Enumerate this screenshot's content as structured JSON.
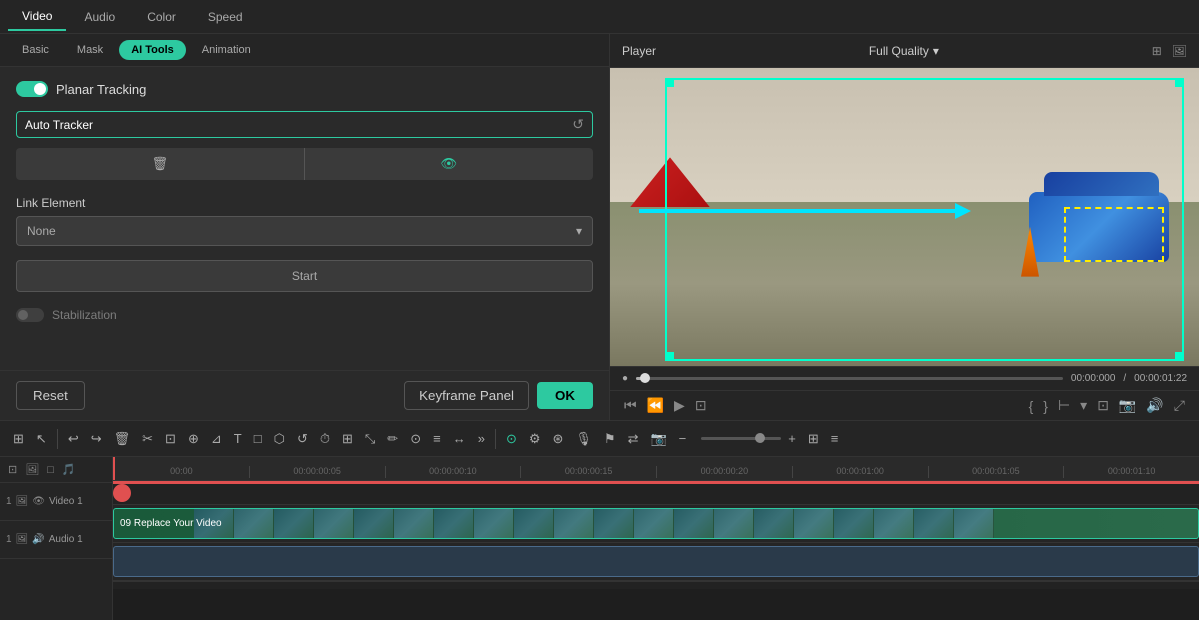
{
  "top_tabs": {
    "tabs": [
      {
        "id": "video",
        "label": "Video",
        "active": true
      },
      {
        "id": "audio",
        "label": "Audio",
        "active": false
      },
      {
        "id": "color",
        "label": "Color",
        "active": false
      },
      {
        "id": "speed",
        "label": "Speed",
        "active": false
      }
    ]
  },
  "sub_tabs": {
    "tabs": [
      {
        "id": "basic",
        "label": "Basic",
        "active": false
      },
      {
        "id": "mask",
        "label": "Mask",
        "active": false
      },
      {
        "id": "ai_tools",
        "label": "AI Tools",
        "active": true
      },
      {
        "id": "animation",
        "label": "Animation",
        "active": false
      }
    ]
  },
  "panel": {
    "planar_tracking_label": "Planar Tracking",
    "tracker_name": "Auto Tracker",
    "link_element_label": "Link Element",
    "link_element_value": "None",
    "start_btn_label": "Start",
    "stabilization_label": "Stabilization",
    "reset_btn": "Reset",
    "keyframe_btn": "Keyframe Panel",
    "ok_btn": "OK"
  },
  "player": {
    "label": "Player",
    "quality_label": "Full Quality",
    "time_current": "00:00:000",
    "time_separator": "/",
    "time_total": "00:00:01:22"
  },
  "toolbar": {
    "tools": [
      "⊞",
      "↖",
      "↩",
      "↪",
      "🗑",
      "✂",
      "⊡",
      "⊕",
      "⊿",
      "¶",
      "□",
      "⊙",
      "↺",
      "↻",
      "⊞",
      "⚙",
      "⊛",
      "✚",
      "⊗",
      "≡",
      "↔",
      "»"
    ],
    "active_tool_index": 14,
    "zoom_minus": "−",
    "zoom_plus": "+",
    "grid_icon": "⊞"
  },
  "timeline": {
    "sidebar_controls": [
      "⊡",
      "🖼",
      "□",
      "🎵"
    ],
    "tracks": [
      {
        "id": "video1",
        "type": "video",
        "label": "Video 1",
        "track_number": "1",
        "clip_name": "09 Replace Your Video",
        "icons": [
          "V",
          "🖼",
          "👁"
        ]
      },
      {
        "id": "audio1",
        "type": "audio",
        "label": "Audio 1",
        "track_number": "1",
        "icons": [
          "A",
          "🖼",
          "🔊"
        ]
      }
    ],
    "ruler_marks": [
      "00:00",
      "00:00:00:05",
      "00:00:00:10",
      "00:00:00:15",
      "00:00:00:20",
      "00:00:01:00",
      "00:00:01:05",
      "00:00:01:10"
    ]
  }
}
